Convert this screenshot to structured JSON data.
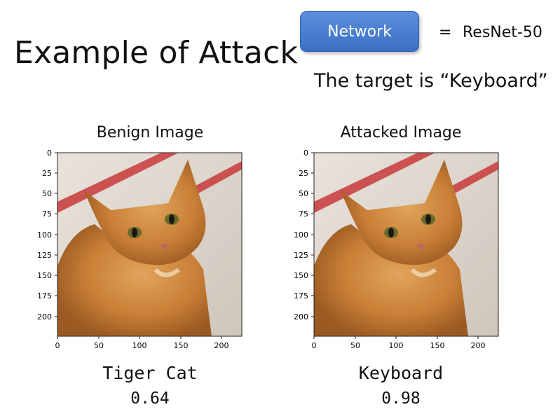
{
  "slide": {
    "title": "Example of Attack"
  },
  "network": {
    "button_label": "Network",
    "equals": "=",
    "model": "ResNet-50"
  },
  "target_text": "The target is “Keyboard”",
  "panels": [
    {
      "title": "Benign Image",
      "prediction": "Tiger Cat",
      "confidence": "0.64"
    },
    {
      "title": "Attacked Image",
      "prediction": "Keyboard",
      "confidence": "0.98"
    }
  ],
  "axes": {
    "y_ticks": [
      "0",
      "25",
      "50",
      "75",
      "100",
      "125",
      "150",
      "175",
      "200"
    ],
    "x_ticks": [
      "0",
      "50",
      "100",
      "150",
      "200"
    ]
  },
  "image_subject": "orange tabby cat photo"
}
